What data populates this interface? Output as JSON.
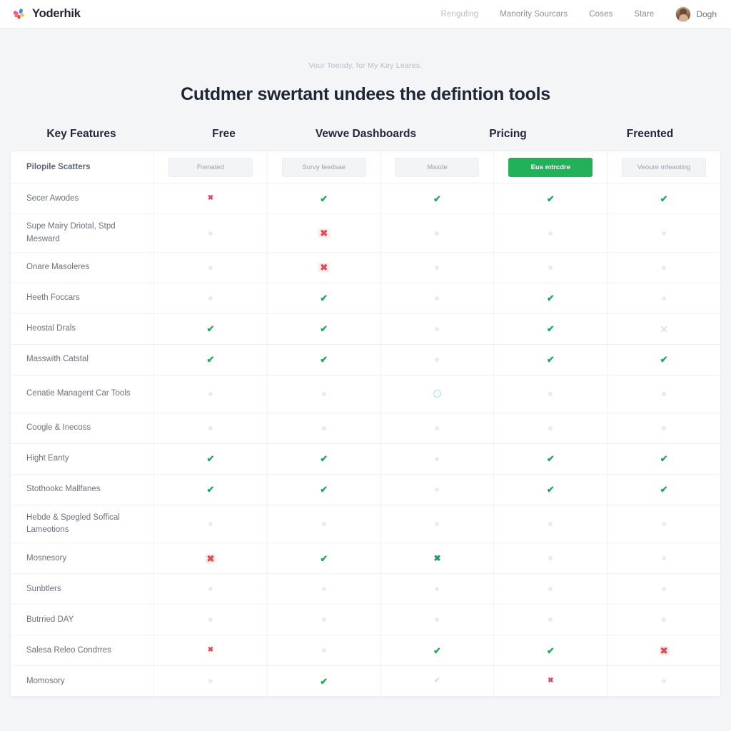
{
  "header": {
    "brand": "Yoderhik",
    "logo_icon": "pinwheel-logo-icon",
    "nav": [
      {
        "label": "Renguling",
        "dim": true
      },
      {
        "label": "Manority Sourcars",
        "dim": false
      },
      {
        "label": "Coses",
        "dim": false
      },
      {
        "label": "Stare",
        "dim": false
      }
    ],
    "user": {
      "name": "Dogh",
      "avatar_icon": "user-avatar"
    }
  },
  "hero": {
    "eyebrow": "Vour Toendy, for My Key Leares.",
    "title": "Cutdmer swertant undees the defintion tools"
  },
  "columns": [
    "Key Features",
    "Free",
    "Vewve Dashboards",
    "Pricing",
    "Freented"
  ],
  "colors": {
    "accent_green": "#22b159",
    "check_green": "#1faa54",
    "cross_red": "#e14a52",
    "text_dark": "#1d2736",
    "text_muted": "#6a727d",
    "page_bg": "#f3f5f7"
  },
  "badge_row": {
    "label": "Pilopile Scatters",
    "badges": [
      {
        "label": "Frenated",
        "active": false
      },
      {
        "label": "Survy feedsae",
        "active": false
      },
      {
        "label": "Maxde",
        "active": false
      },
      {
        "label": "Eus mtrcdre",
        "active": true
      },
      {
        "label": "Veoure mfeaoting",
        "active": false
      }
    ]
  },
  "rows": [
    {
      "label": "Secer Awodes",
      "tall": false,
      "marks": [
        "x-sm",
        "check",
        "check",
        "check",
        "check"
      ]
    },
    {
      "label": "Supe Mairy Driotal, Stpd Mesward",
      "tall": true,
      "marks": [
        "dot",
        "x",
        "dot",
        "dot",
        "dot"
      ]
    },
    {
      "label": "Onare Masoleres",
      "tall": false,
      "marks": [
        "dot",
        "x",
        "dot",
        "dot",
        "dot"
      ]
    },
    {
      "label": "Heeth Foccars",
      "tall": false,
      "marks": [
        "dot",
        "check",
        "dot",
        "check",
        "dot"
      ]
    },
    {
      "label": "Heostal Drals",
      "tall": false,
      "marks": [
        "check",
        "check",
        "dot",
        "check",
        "x-faint"
      ]
    },
    {
      "label": "Masswith Catstal",
      "tall": false,
      "marks": [
        "check",
        "check",
        "dot",
        "check",
        "check"
      ]
    },
    {
      "label": "Cenatie Managent Car Tools",
      "tall": true,
      "marks": [
        "dot",
        "dot",
        "circle",
        "dot",
        "dot"
      ]
    },
    {
      "label": "Coogle & Inecoss",
      "tall": false,
      "marks": [
        "dot",
        "dot",
        "dot",
        "dot",
        "dot"
      ]
    },
    {
      "label": "Hight Eanty",
      "tall": false,
      "marks": [
        "check",
        "check",
        "dot",
        "check",
        "check"
      ]
    },
    {
      "label": "Stothookc Mallfanes",
      "tall": false,
      "marks": [
        "check",
        "check",
        "dot",
        "check",
        "check"
      ]
    },
    {
      "label": "Hebde & Spegled Soffical Lameotions",
      "tall": true,
      "marks": [
        "dot",
        "dot",
        "dot",
        "dot",
        "dot"
      ]
    },
    {
      "label": "Mosnesory",
      "tall": false,
      "marks": [
        "x",
        "check",
        "x-green",
        "dot",
        "dot"
      ]
    },
    {
      "label": "Sunbtlers",
      "tall": false,
      "marks": [
        "dot",
        "dot",
        "dot",
        "dot",
        "dot"
      ]
    },
    {
      "label": "Butrried DAY",
      "tall": false,
      "marks": [
        "dot",
        "dot",
        "dot",
        "dot",
        "dot"
      ]
    },
    {
      "label": "Salesa Releo Condrres",
      "tall": false,
      "marks": [
        "x-sm",
        "dot",
        "check",
        "check",
        "x"
      ]
    },
    {
      "label": "Momosory",
      "tall": false,
      "marks": [
        "dot",
        "check",
        "check-faint",
        "x-sm",
        "dot"
      ]
    }
  ]
}
